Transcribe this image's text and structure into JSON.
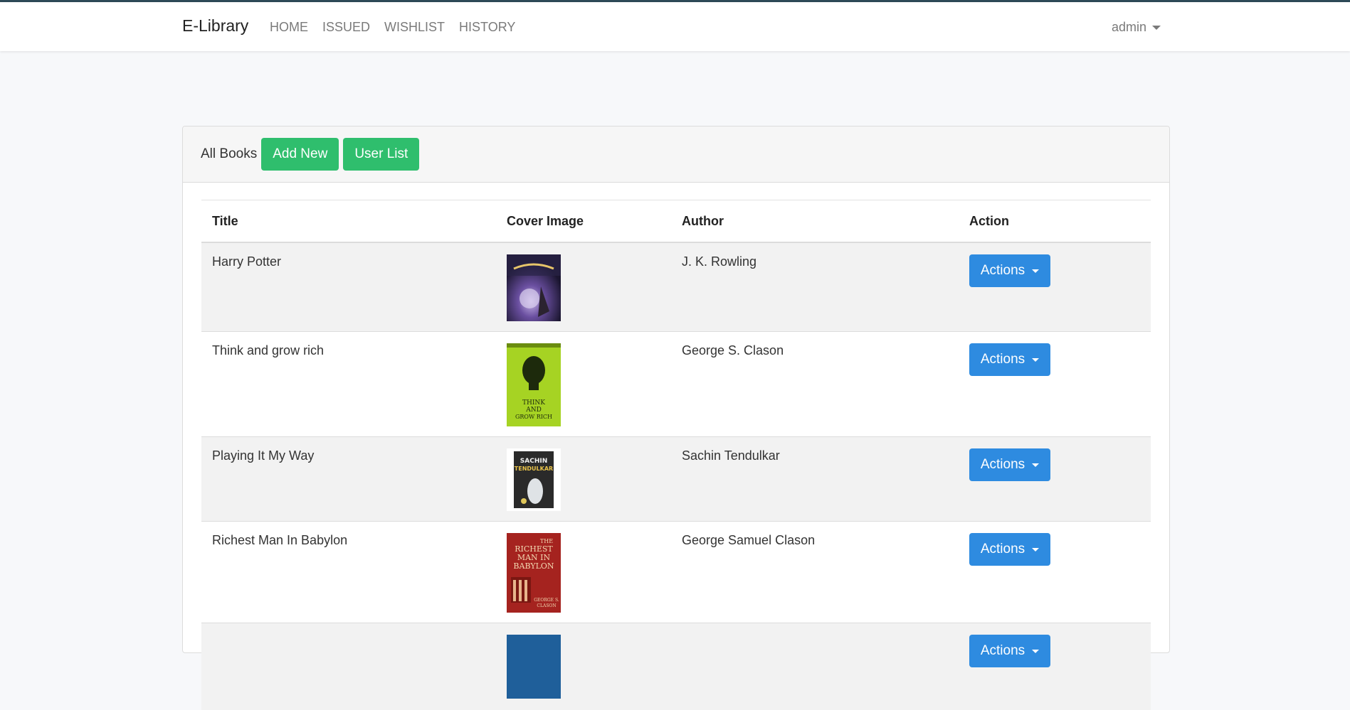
{
  "app": {
    "brand": "E-Library",
    "user": "admin"
  },
  "nav": [
    {
      "label": "HOME"
    },
    {
      "label": "ISSUED"
    },
    {
      "label": "WISHLIST"
    },
    {
      "label": "HISTORY"
    }
  ],
  "card": {
    "heading": "All Books",
    "add_label": "Add New",
    "users_label": "User List"
  },
  "table": {
    "headers": [
      "Title",
      "Cover Image",
      "Author",
      "Action"
    ],
    "rows": [
      {
        "title": "Harry Potter",
        "author": "J. K. Rowling",
        "action": "Actions"
      },
      {
        "title": "Think and grow rich",
        "author": "George S. Clason",
        "action": "Actions"
      },
      {
        "title": "Playing It My Way",
        "author": "Sachin Tendulkar",
        "action": "Actions"
      },
      {
        "title": "Richest Man In Babylon",
        "author": "George Samuel Clason",
        "action": "Actions"
      },
      {
        "title": "",
        "author": "",
        "action": "Actions"
      }
    ]
  },
  "colors": {
    "accent_green": "#2fbe6d",
    "accent_blue": "#2e8be0"
  }
}
